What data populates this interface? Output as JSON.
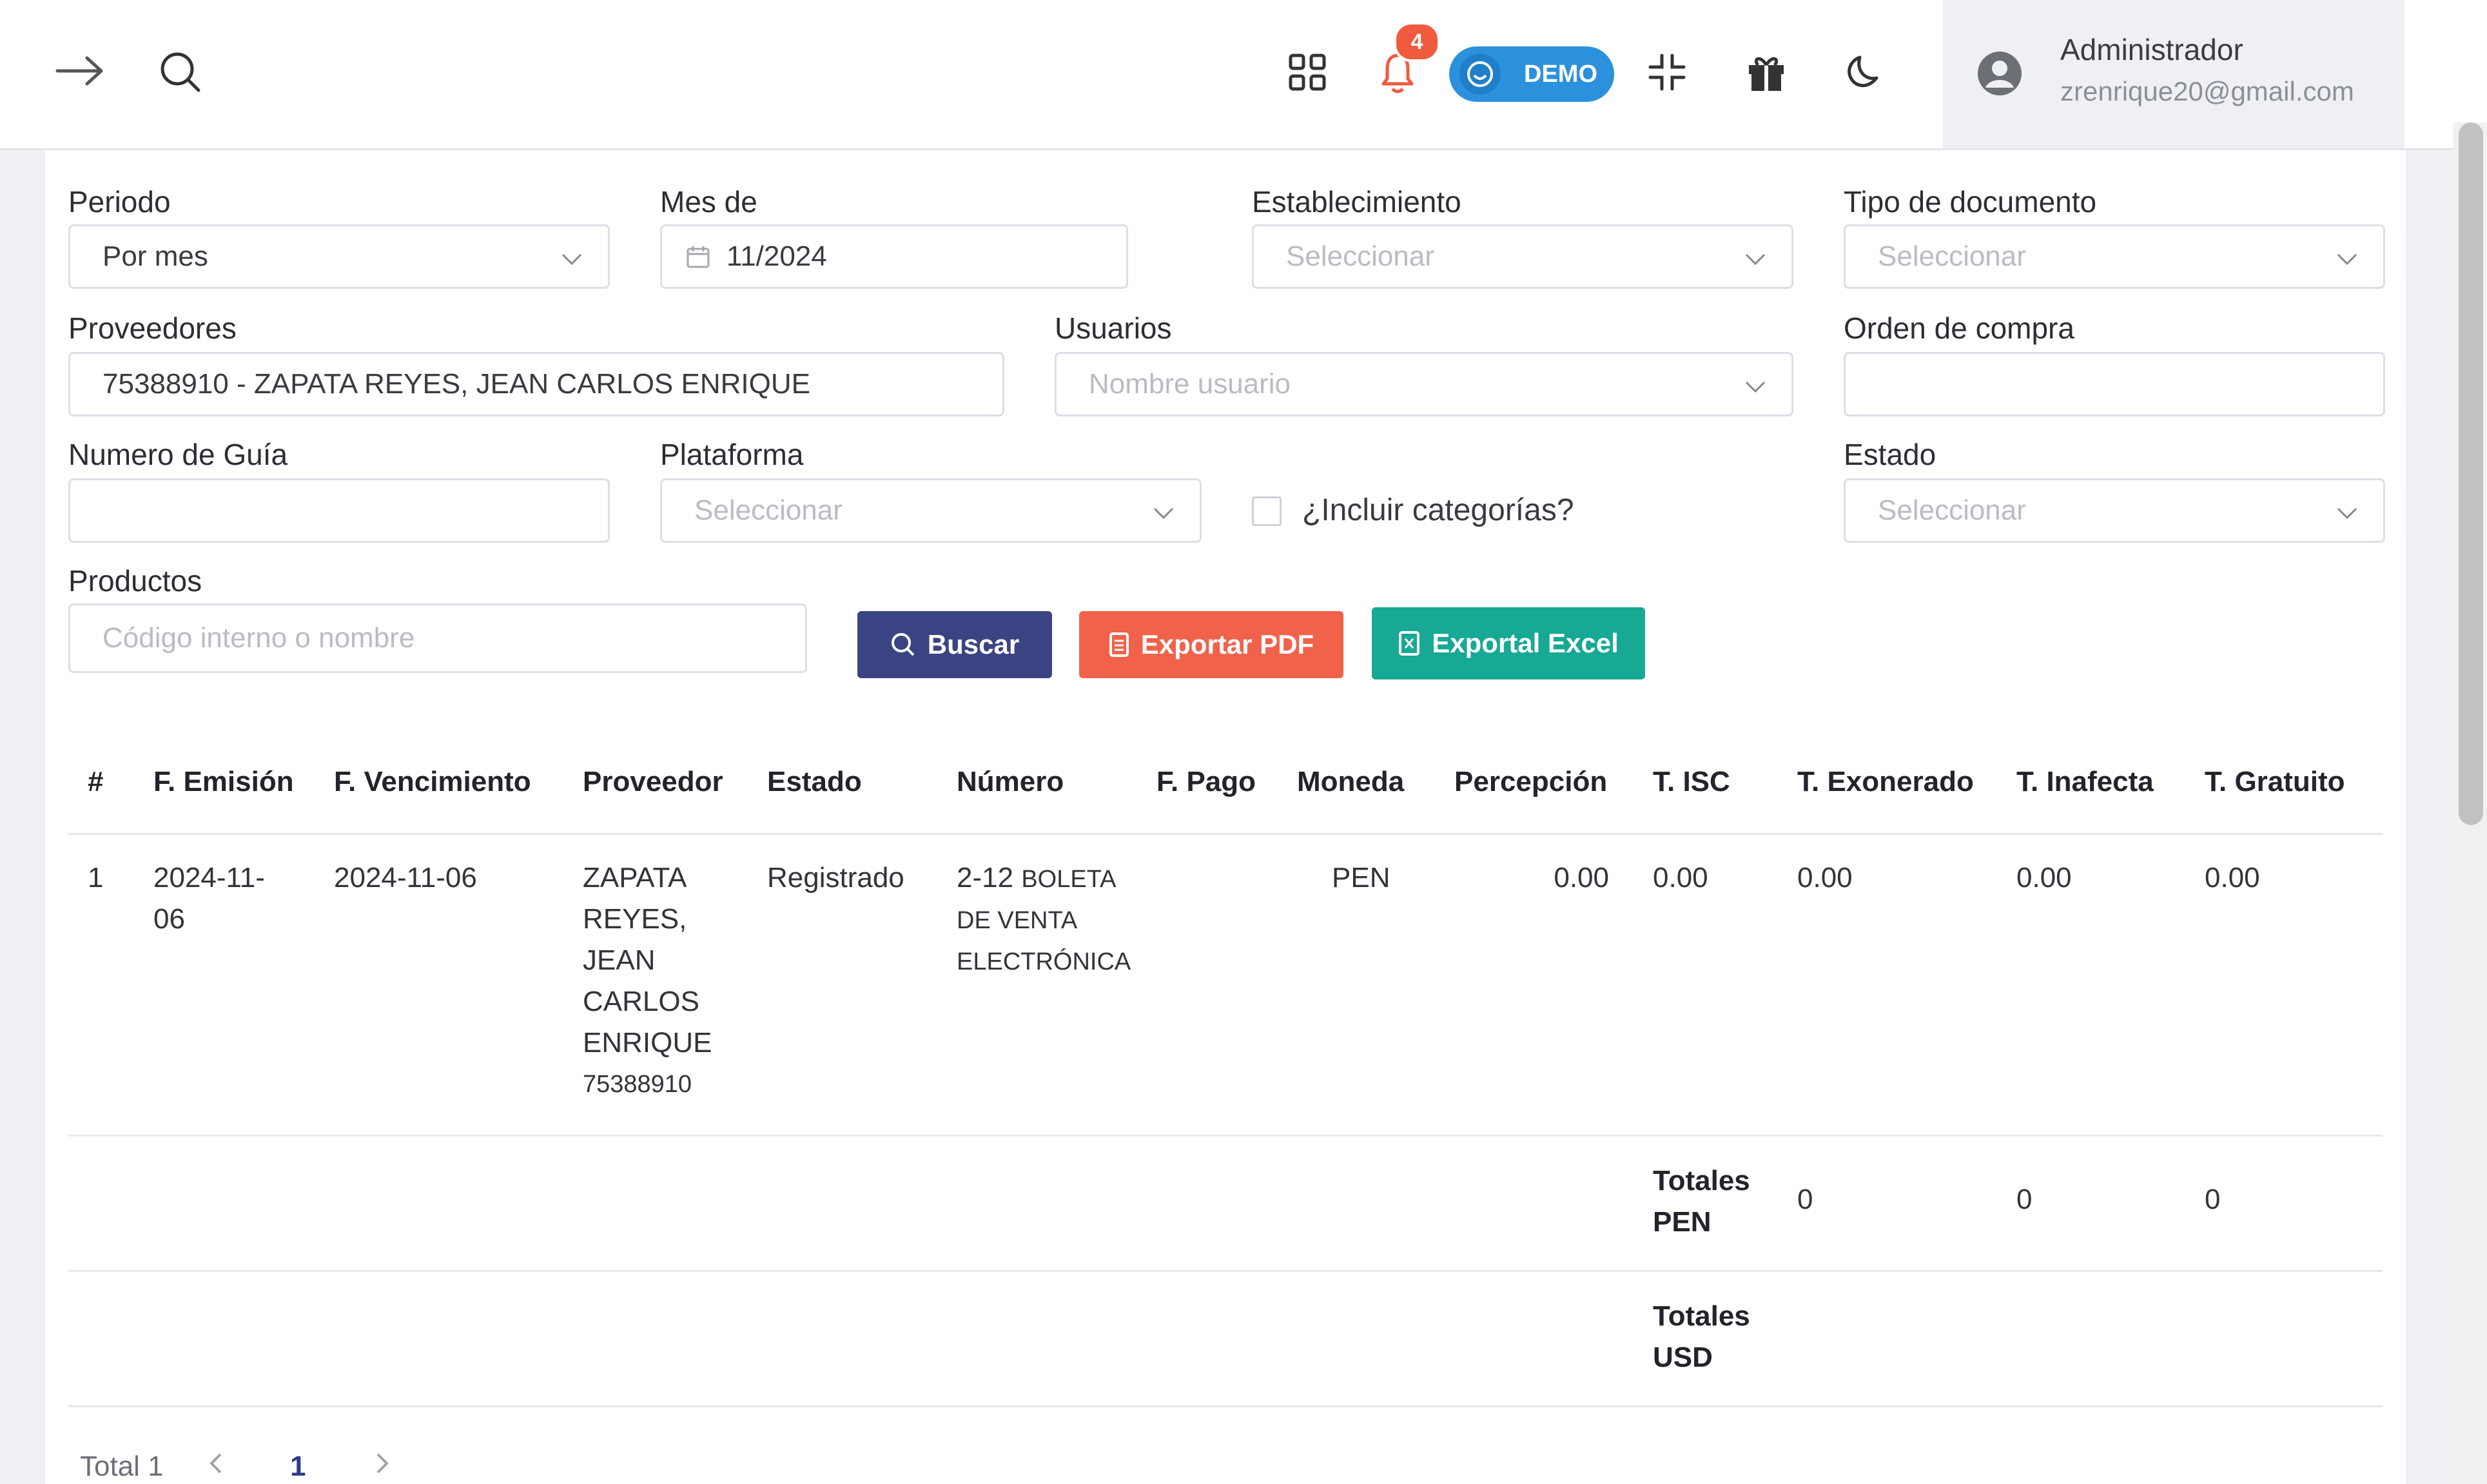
{
  "topbar": {
    "notification_count": "4",
    "demo_label": "DEMO",
    "user_name": "Administrador",
    "user_email": "zrenrique20@gmail.com"
  },
  "filters": {
    "periodo": {
      "label": "Periodo",
      "value": "Por mes"
    },
    "mes_de": {
      "label": "Mes de",
      "value": "11/2024"
    },
    "establecimiento": {
      "label": "Establecimiento",
      "placeholder": "Seleccionar"
    },
    "tipo_documento": {
      "label": "Tipo de documento",
      "placeholder": "Seleccionar"
    },
    "proveedores": {
      "label": "Proveedores",
      "value": "75388910 - ZAPATA REYES, JEAN CARLOS ENRIQUE"
    },
    "usuarios": {
      "label": "Usuarios",
      "placeholder": "Nombre usuario"
    },
    "orden_compra": {
      "label": "Orden de compra",
      "value": ""
    },
    "numero_guia": {
      "label": "Numero de Guía",
      "value": ""
    },
    "plataforma": {
      "label": "Plataforma",
      "placeholder": "Seleccionar"
    },
    "incluir_categorias": {
      "label": "¿Incluir categorías?",
      "checked": false
    },
    "estado": {
      "label": "Estado",
      "placeholder": "Seleccionar"
    },
    "productos": {
      "label": "Productos",
      "placeholder": "Código interno o nombre"
    }
  },
  "actions": {
    "buscar": "Buscar",
    "exportar_pdf": "Exportar PDF",
    "exportar_excel": "Exportal Excel"
  },
  "colors": {
    "buscar": "#3b4482",
    "pdf": "#f0624a",
    "excel": "#17a994"
  },
  "table": {
    "headers": [
      "#",
      "F. Emisión",
      "F. Vencimiento",
      "Proveedor",
      "Estado",
      "Número",
      "F. Pago",
      "Moneda",
      "Percepción",
      "T. ISC",
      "T. Exonerado",
      "T. Inafecta",
      "T. Gratuito"
    ],
    "rows": [
      {
        "num": "1",
        "emision": [
          "2024-11-",
          "06"
        ],
        "vencimiento": "2024-11-06",
        "proveedor": [
          "ZAPATA",
          "REYES,",
          "JEAN",
          "CARLOS",
          "ENRIQUE"
        ],
        "proveedor_doc": "75388910",
        "estado": "Registrado",
        "numero_serie": "2-12",
        "numero_tipo": [
          "BOLETA",
          "DE VENTA",
          "ELECTRÓNICA"
        ],
        "pago": "",
        "moneda": "PEN",
        "percepcion": "0.00",
        "isc": "0.00",
        "exonerado": "0.00",
        "inafecta": "0.00",
        "gratuito": "0.00"
      }
    ],
    "totals_pen": {
      "label": [
        "Totales",
        "PEN"
      ],
      "exonerado": "0",
      "inafecta": "0",
      "gratuito": "0"
    },
    "totals_usd": {
      "label": [
        "Totales",
        "USD"
      ]
    }
  },
  "pagination": {
    "total": "Total 1",
    "current_page": "1"
  }
}
